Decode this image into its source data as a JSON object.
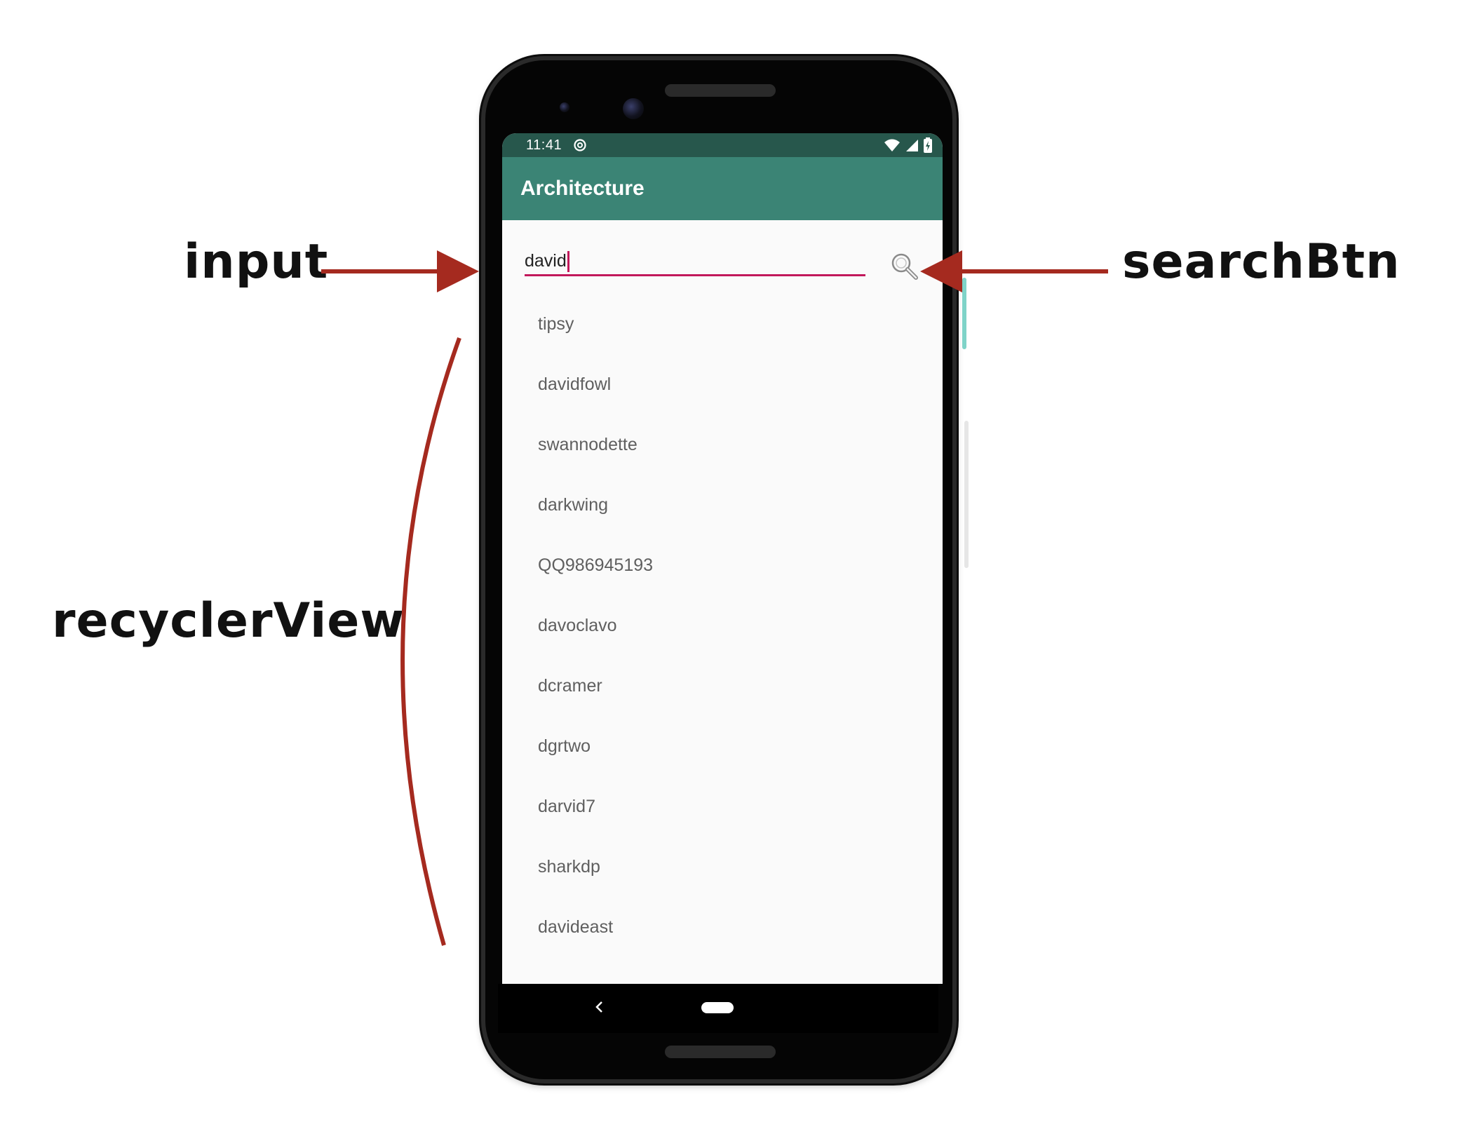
{
  "annotations": {
    "input": "input",
    "searchBtn": "searchBtn",
    "recyclerView": "recyclerView",
    "arrow_color": "#a52a1f"
  },
  "status_bar": {
    "time": "11:41",
    "background": "#27574c"
  },
  "app_bar": {
    "title": "Architecture",
    "background": "#3b8475"
  },
  "search": {
    "value": "david",
    "underline_color": "#c2185b",
    "button_icon": "search-icon"
  },
  "user_list": [
    "tipsy",
    "davidfowl",
    "swannodette",
    "darkwing",
    "QQ986945193",
    "davoclavo",
    "dcramer",
    "dgrtwo",
    "darvid7",
    "sharkdp",
    "davideast"
  ],
  "navigation": {
    "back_icon": "back-icon",
    "home_icon": "home-pill-icon"
  }
}
